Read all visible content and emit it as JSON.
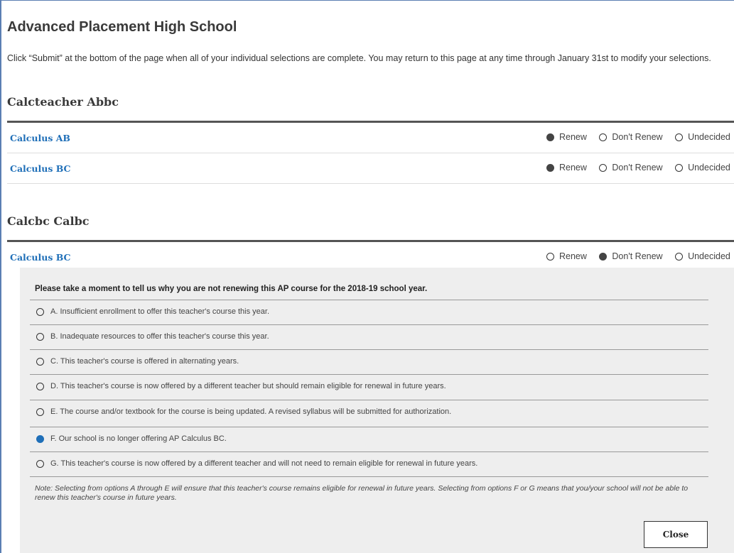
{
  "school": {
    "title": "Advanced Placement High School"
  },
  "intro": "Click “Submit” at the bottom of the page when all of your individual selections are complete. You may return to this page at any time through January 31st to modify your selections.",
  "labels": {
    "renew": "Renew",
    "dont_renew": "Don't Renew",
    "undecided": "Undecided"
  },
  "teachers": [
    {
      "name": "Calcteacher Abbc",
      "courses": [
        {
          "name": "Calculus AB",
          "selection": "renew"
        },
        {
          "name": "Calculus BC",
          "selection": "renew"
        }
      ]
    },
    {
      "name": "Calcbc Calbc",
      "courses": [
        {
          "name": "Calculus BC",
          "selection": "dont_renew"
        }
      ]
    }
  ],
  "panel": {
    "question": "Please take a moment to tell us why you are not renewing this AP course for the 2018-19 school year.",
    "reasons": [
      "A. Insufficient enrollment to offer this teacher's course this year.",
      "B. Inadequate resources to offer this teacher's course this year.",
      "C. This teacher's course is offered in alternating years.",
      "D. This teacher's course is now offered by a different teacher but should remain eligible for renewal in future years.",
      "E. The course and/or textbook for the course is being updated. A revised syllabus will be submitted for authorization.",
      "F. Our school is no longer offering AP Calculus BC.",
      "G. This teacher's course is now offered by a different teacher and will not need to remain eligible for renewal in future years."
    ],
    "selected_reason_index": 5,
    "note": "Note: Selecting from options A through E will ensure that this teacher's course remains eligible for renewal in future years. Selecting from options F or G means that you/your school will not be able to renew this teacher's course in future years.",
    "close_label": "Close"
  },
  "colors": {
    "link": "#1f6fb8",
    "selected_reason": "#1f6fb8",
    "frame": "#5b7fb3"
  }
}
